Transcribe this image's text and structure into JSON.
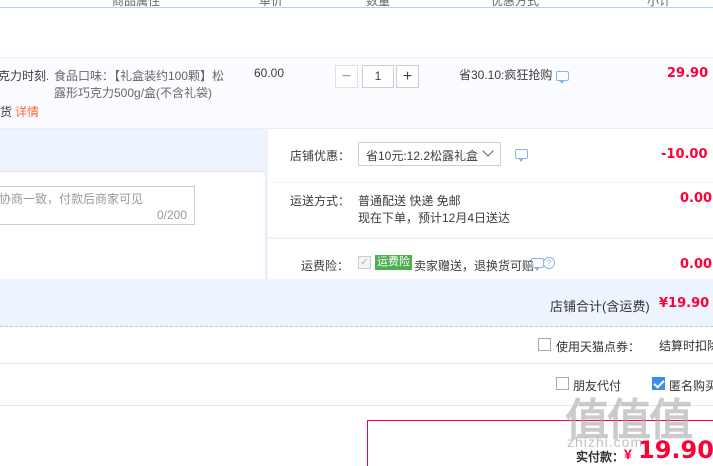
{
  "header": {
    "col_attr": "商品属性",
    "col_price": "单价",
    "col_qty": "数量",
    "col_promo": "优惠方式",
    "col_subtotal": "小计"
  },
  "item": {
    "title_fragment": "克力时刻...",
    "title_line2_fragment": "货",
    "detail_link": "详情",
    "attr_line1": "食品口味：【礼盒装约100颗】松",
    "attr_line2": "露形巧克力500g/盒(不含礼袋)",
    "unit_price": "60.00",
    "minus": "−",
    "quantity": "1",
    "plus": "+",
    "promo": "省30.10:疯狂抢购",
    "subtotal": "29.90"
  },
  "store": {
    "message_placeholder": "协商一致，付款后商家可见",
    "message_count": "0/200",
    "discount_label": "店铺优惠：",
    "discount_select": "省10元:12.2松露礼盒",
    "discount_amount": "-10.00",
    "shipping_label": "运送方式：",
    "shipping_method": "普通配送 快递 免邮",
    "shipping_eta": "现在下单，预计12月4日送达",
    "shipping_amount": "0.00",
    "insurance_label": "运费险：",
    "insurance_badge": "运费险",
    "insurance_text": "卖家赠送，退换货可赔",
    "insurance_amount": "0.00",
    "help_glyph": "?"
  },
  "subtotal": {
    "label": "店铺合计(含运费)",
    "amount": "¥19.90"
  },
  "options": {
    "tmall_points_label": "使用天猫点券：",
    "tmall_points_note": "结算时扣除",
    "friend_pay_label": "朋友代付",
    "anonymous_label": "匿名购买"
  },
  "payment": {
    "label": "实付款：",
    "currency": "¥",
    "amount": "19.90"
  },
  "watermark": {
    "glyphs": "值值值",
    "site": "zhizhi.com"
  },
  "colors": {
    "accent_red": "#ff0036",
    "panel_blue": "#eef4fd",
    "badge_green": "#4caf50",
    "check_blue": "#3c8cf0"
  }
}
